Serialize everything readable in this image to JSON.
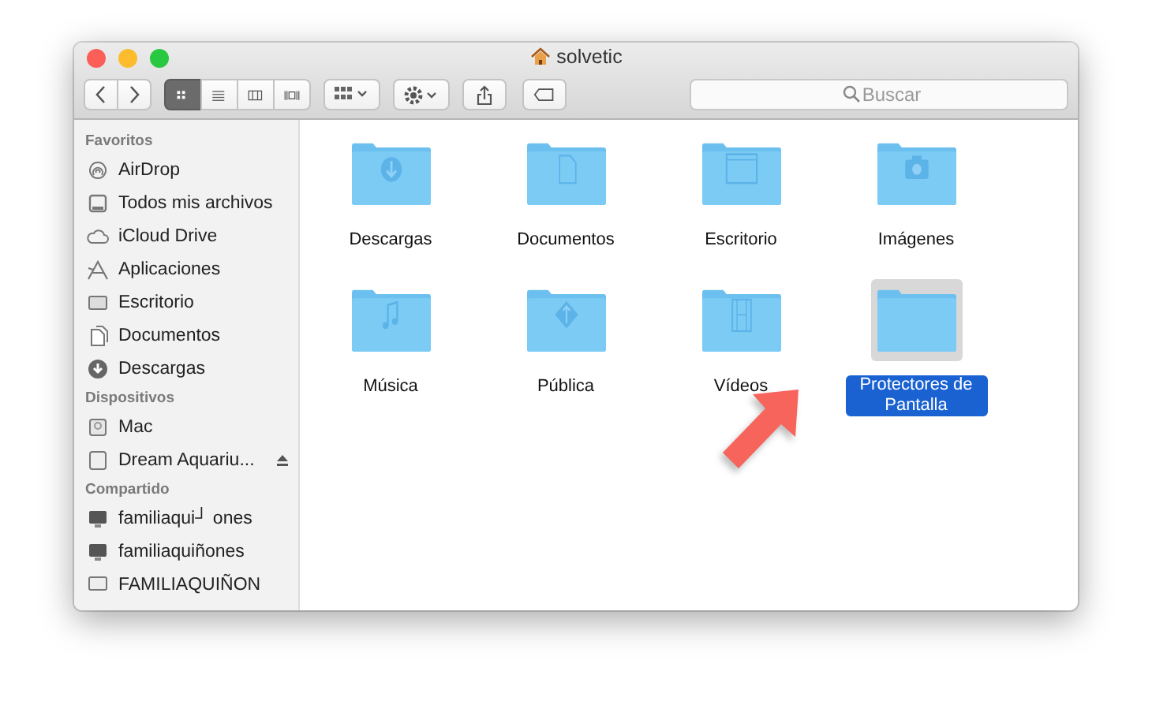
{
  "window": {
    "title": "solvetic"
  },
  "toolbar": {
    "views": [
      {
        "selected": true
      },
      {
        "selected": false
      },
      {
        "selected": false
      },
      {
        "selected": false
      }
    ],
    "search": {
      "placeholder": "Buscar"
    }
  },
  "sidebar": {
    "sections": [
      {
        "title": "Favoritos",
        "items": [
          {
            "label": "AirDrop",
            "eject": false
          },
          {
            "label": "Todos mis archivos",
            "eject": false
          },
          {
            "label": "iCloud Drive",
            "eject": false
          },
          {
            "label": "Aplicaciones",
            "eject": false
          },
          {
            "label": "Escritorio",
            "eject": false
          },
          {
            "label": "Documentos",
            "eject": false
          },
          {
            "label": "Descargas",
            "eject": false
          }
        ]
      },
      {
        "title": "Dispositivos",
        "items": [
          {
            "label": "Mac",
            "eject": false
          },
          {
            "label": "Dream Aquariu...",
            "eject": true
          }
        ]
      },
      {
        "title": "Compartido",
        "items": [
          {
            "label": "familiaqui┘ ones",
            "eject": false
          },
          {
            "label": "familiaquiñones",
            "eject": false
          },
          {
            "label": "FAMILIAQUIÑON",
            "eject": false
          }
        ]
      }
    ]
  },
  "folders": [
    {
      "name": "Descargas",
      "selected": false
    },
    {
      "name": "Documentos",
      "selected": false
    },
    {
      "name": "Escritorio",
      "selected": false
    },
    {
      "name": "Imágenes",
      "selected": false
    },
    {
      "name": "Música",
      "selected": false
    },
    {
      "name": "Pública",
      "selected": false
    },
    {
      "name": "Vídeos",
      "selected": false
    },
    {
      "name": "Protectores de Pantalla",
      "selected": true
    }
  ]
}
